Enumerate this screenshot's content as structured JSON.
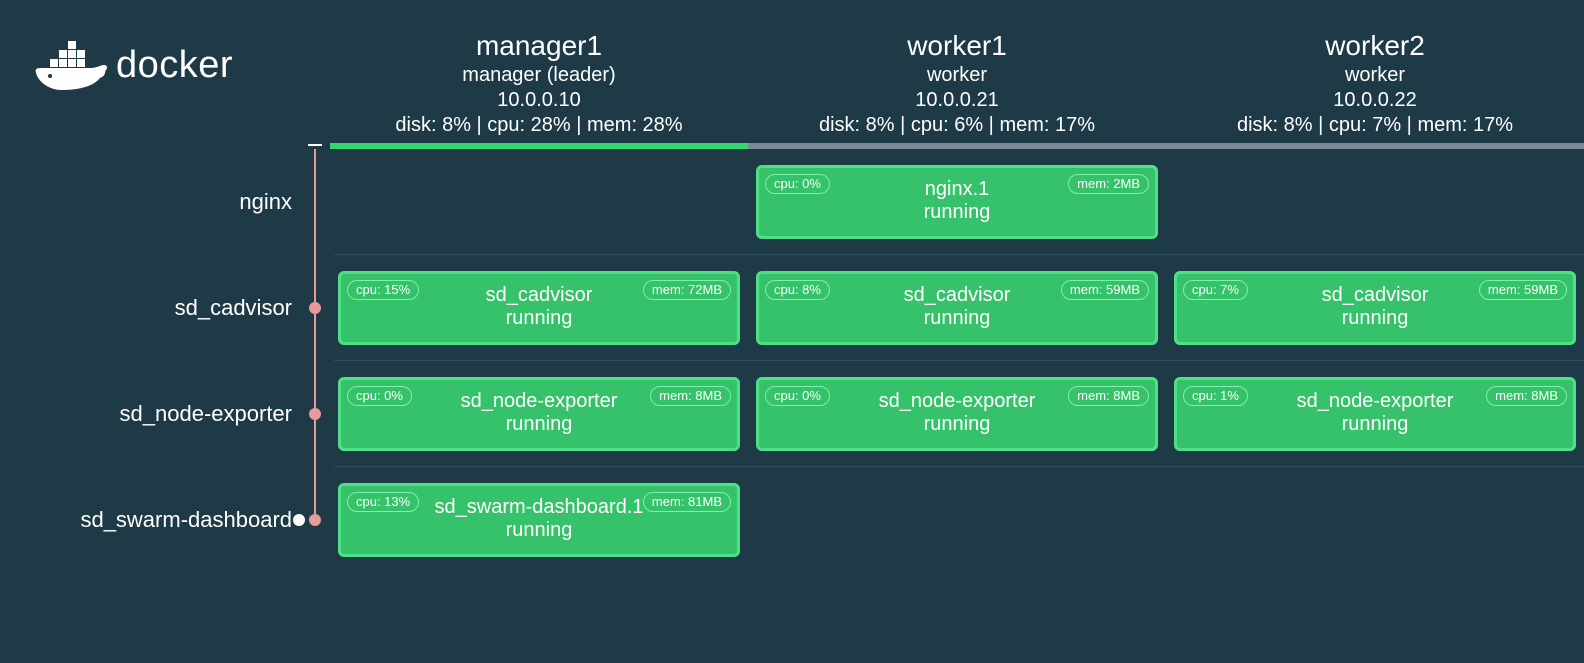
{
  "brand": "docker",
  "nodes": [
    {
      "name": "manager1",
      "role": "manager (leader)",
      "ip": "10.0.0.10",
      "stats": "disk: 8% | cpu: 28% | mem: 28%",
      "leader": true
    },
    {
      "name": "worker1",
      "role": "worker",
      "ip": "10.0.0.21",
      "stats": "disk: 8% | cpu: 6% | mem: 17%",
      "leader": false
    },
    {
      "name": "worker2",
      "role": "worker",
      "ip": "10.0.0.22",
      "stats": "disk: 8% | cpu: 7% | mem: 17%",
      "leader": false
    }
  ],
  "rows": [
    {
      "label": "nginx",
      "show_dot": false,
      "cells": [
        null,
        {
          "cpu": "cpu: 0%",
          "mem": "mem: 2MB",
          "name": "nginx.1",
          "status": "running"
        },
        null
      ]
    },
    {
      "label": "sd_cadvisor",
      "show_dot": true,
      "cells": [
        {
          "cpu": "cpu: 15%",
          "mem": "mem: 72MB",
          "name": "sd_cadvisor",
          "status": "running"
        },
        {
          "cpu": "cpu: 8%",
          "mem": "mem: 59MB",
          "name": "sd_cadvisor",
          "status": "running"
        },
        {
          "cpu": "cpu: 7%",
          "mem": "mem: 59MB",
          "name": "sd_cadvisor",
          "status": "running"
        }
      ]
    },
    {
      "label": "sd_node-exporter",
      "show_dot": true,
      "cells": [
        {
          "cpu": "cpu: 0%",
          "mem": "mem: 8MB",
          "name": "sd_node-exporter",
          "status": "running"
        },
        {
          "cpu": "cpu: 0%",
          "mem": "mem: 8MB",
          "name": "sd_node-exporter",
          "status": "running"
        },
        {
          "cpu": "cpu: 1%",
          "mem": "mem: 8MB",
          "name": "sd_node-exporter",
          "status": "running"
        }
      ]
    },
    {
      "label": "sd_swarm-dashboard",
      "show_dot": true,
      "show_white_dot": true,
      "cells": [
        {
          "cpu": "cpu: 13%",
          "mem": "mem: 81MB",
          "name": "sd_swarm-dashboard.1",
          "status": "running"
        },
        null,
        null
      ]
    }
  ]
}
